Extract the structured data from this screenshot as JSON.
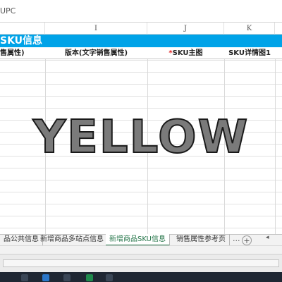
{
  "formula_bar": {
    "cell_text": "UPC"
  },
  "columns": [
    "I",
    "J",
    "K"
  ],
  "section": {
    "title": "SKU信息"
  },
  "header_row": {
    "h1": "售属性)",
    "h2": "版本(文字销售属性)",
    "h3_required_mark": "*",
    "h3": "SKU主图",
    "h4": "SKU详情图1"
  },
  "watermark": "YELLOW",
  "sheet_tabs": [
    {
      "label": "品公共信息",
      "active": false
    },
    {
      "label": "新增商品多站点信息",
      "active": false
    },
    {
      "label": "新增商品SKU信息",
      "active": true
    },
    {
      "label": "销售属性参考页",
      "active": false
    }
  ],
  "tab_controls": {
    "more": "...",
    "add": "+",
    "scroll": "◂"
  },
  "colors": {
    "banner": "#00a3e8",
    "active_tab": "#217346",
    "required": "#e02020"
  }
}
